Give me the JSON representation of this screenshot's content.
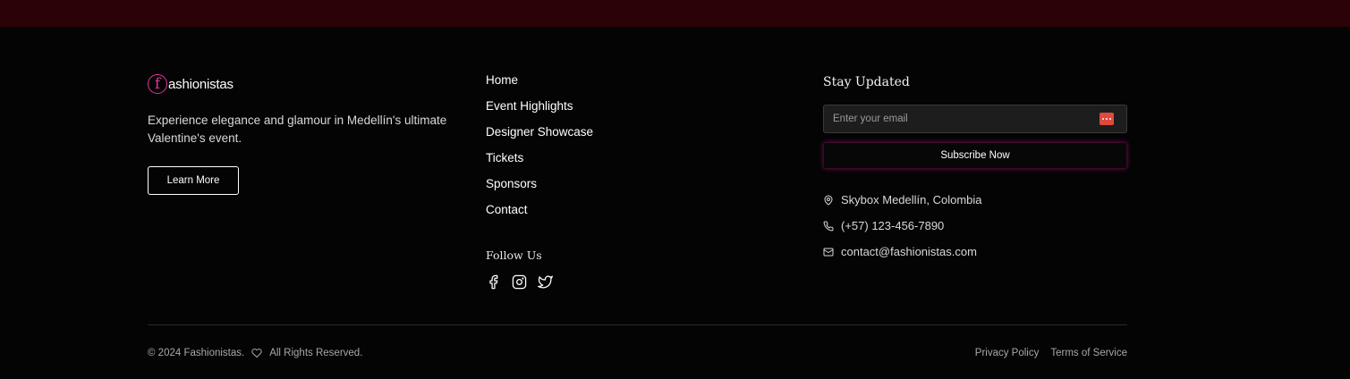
{
  "brand": {
    "logo_letter": "f",
    "logo_text": "ashionistas",
    "tagline": "Experience elegance and glamour in Medellín's ultimate Valentine's event.",
    "learn_more": "Learn More",
    "accent": "#e0369a"
  },
  "nav": {
    "items": [
      "Home",
      "Event Highlights",
      "Designer Showcase",
      "Tickets",
      "Sponsors",
      "Contact"
    ]
  },
  "social": {
    "title": "Follow Us",
    "icons": [
      "facebook-icon",
      "instagram-icon",
      "twitter-icon"
    ]
  },
  "newsletter": {
    "title": "Stay Updated",
    "email_placeholder": "Enter your email",
    "email_value": "",
    "subscribe_label": "Subscribe Now"
  },
  "contact": {
    "address": "Skybox Medellín, Colombia",
    "phone": "(+57) 123-456-7890",
    "email": "contact@fashionistas.com"
  },
  "bottom": {
    "copyright_left": "© 2024 Fashionistas.",
    "copyright_right": "All Rights Reserved.",
    "privacy": "Privacy Policy",
    "terms": "Terms of Service"
  },
  "colors": {
    "top_band": "#2a0207",
    "background": "#040404",
    "password_icon": "#e04a3c"
  }
}
